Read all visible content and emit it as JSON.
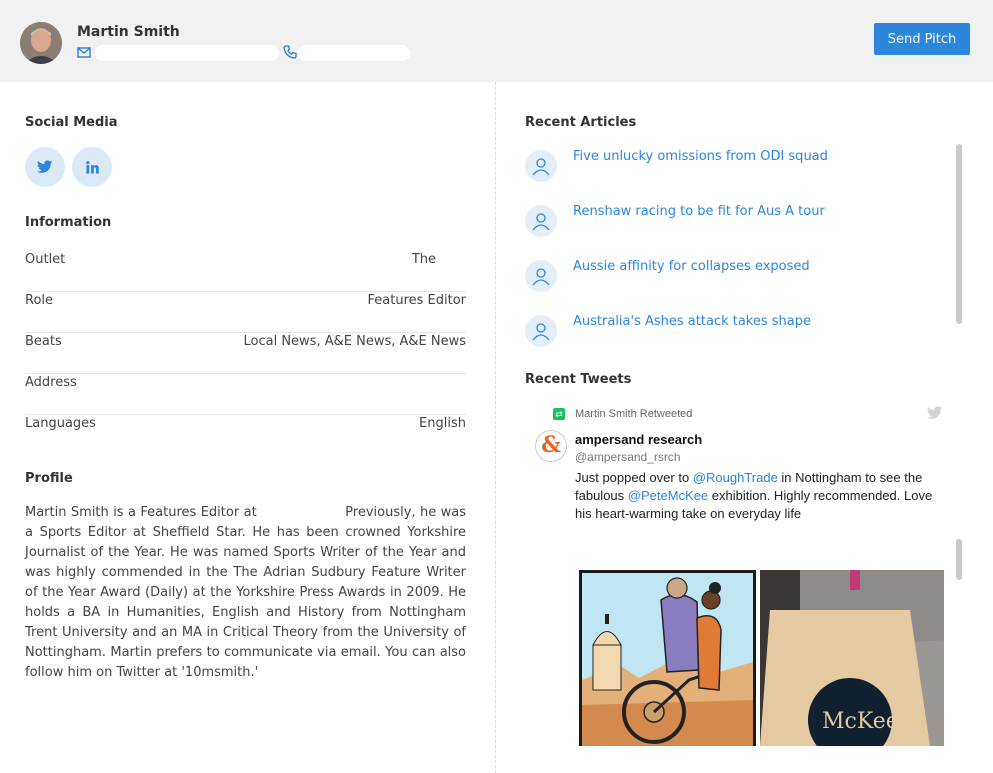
{
  "header": {
    "name": "Martin Smith",
    "send_label": "Send Pitch"
  },
  "left": {
    "social_title": "Social Media",
    "info_title": "Information",
    "info_rows": [
      {
        "label": "Outlet",
        "value": "The"
      },
      {
        "label": "Role",
        "value": "Features Editor"
      },
      {
        "label": "Beats",
        "value": "Local News, A&E News, A&E News"
      },
      {
        "label": "Address",
        "value": ""
      },
      {
        "label": "Languages",
        "value": "English"
      }
    ],
    "profile_title": "Profile",
    "profile_text": "Martin Smith is a Features Editor at                    Previously, he was a Sports Editor at Sheffield Star. He has been crowned Yorkshire Journalist of the Year. He was named Sports Writer of the Year and was highly commended in the The Adrian Sudbury Feature Writer of the Year Award (Daily) at the Yorkshire Press Awards in 2009. He holds a BA in Humanities, English and History from Nottingham Trent University and an MA in Critical Theory from the University of Nottingham. Martin prefers to communicate via email. You can also follow him on Twitter at '10msmith.'"
  },
  "right": {
    "articles_title": "Recent Articles",
    "articles": [
      "Five unlucky omissions from ODI squad",
      "Renshaw racing to be fit for Aus A tour",
      "Aussie affinity for collapses exposed",
      "Australia's Ashes attack takes shape"
    ],
    "tweets_title": "Recent Tweets",
    "tweet": {
      "retweet_text": "Martin Smith Retweeted",
      "author": "ampersand research",
      "handle": "@ampersand_rsrch",
      "text_1": "Just popped over to ",
      "mention_1": "@RoughTrade",
      "text_2": " in Nottingham to see the fabulous ",
      "mention_2": "@PeteMcKee",
      "text_3": " exhibition.  Highly recommended.  Love his heart-warming take on everyday life",
      "avatar_glyph": "&",
      "sign_text": "McKee"
    }
  },
  "colors": {
    "accent": "#2a87dd",
    "header_bg": "#f1f1f1",
    "retweet_green": "#19bf64"
  },
  "icons": {
    "email": "envelope-icon",
    "phone": "phone-icon",
    "twitter": "twitter-icon",
    "linkedin": "linkedin-icon",
    "article": "user-icon"
  }
}
